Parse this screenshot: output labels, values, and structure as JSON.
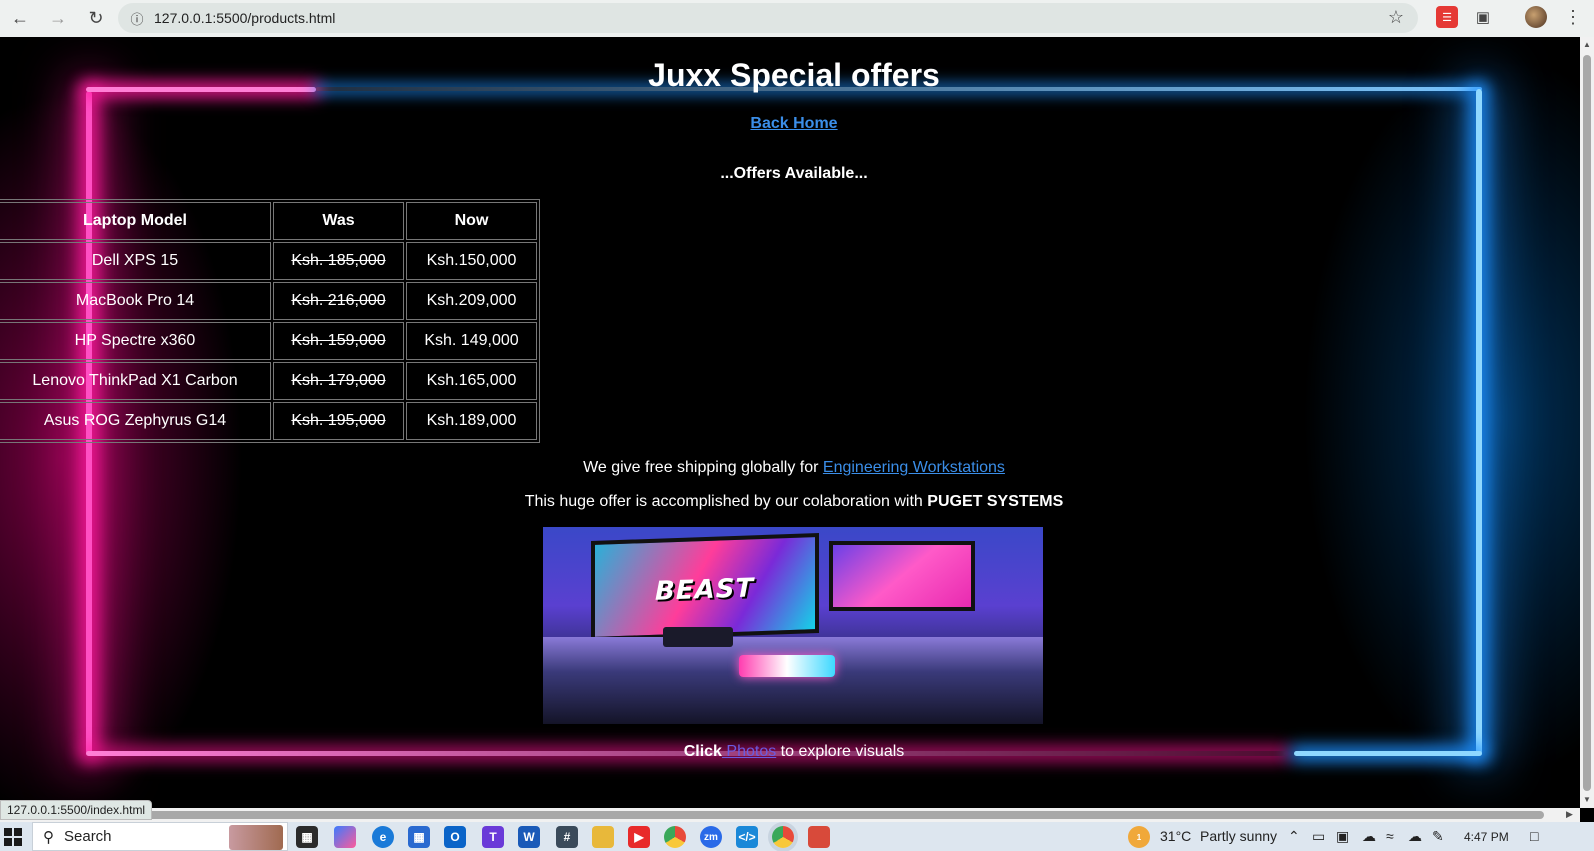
{
  "browser": {
    "url": "127.0.0.1:5500/products.html",
    "status_url": "127.0.0.1:5500/index.html"
  },
  "page": {
    "title": "Juxx Special offers",
    "back_link": "Back Home",
    "offers_heading": "...Offers Available...",
    "table": {
      "headers": [
        "Laptop Model",
        "Was",
        "Now"
      ],
      "rows": [
        {
          "model": "Dell XPS 15",
          "was": "Ksh. 185,000",
          "now": "Ksh.150,000"
        },
        {
          "model": "MacBook Pro 14",
          "was": "Ksh. 216,000",
          "now": "Ksh.209,000"
        },
        {
          "model": "HP Spectre x360",
          "was": "Ksh. 159,000",
          "now": "Ksh. 149,000"
        },
        {
          "model": "Lenovo ThinkPad X1 Carbon",
          "was": "Ksh. 179,000",
          "now": "Ksh.165,000"
        },
        {
          "model": "Asus ROG Zephyrus G14",
          "was": "Ksh. 195,000",
          "now": "Ksh.189,000"
        }
      ]
    },
    "shipping_text": "We give free shipping globally for",
    "shipping_link": "Engineering Workstations",
    "collab_text": "This huge offer is accomplished by our colaboration with",
    "collab_partner": "PUGET SYSTEMS",
    "image_caption_text": "BEAST",
    "click_prefix": "Click",
    "click_link": " Photos",
    "click_suffix": " to explore visuals"
  },
  "taskbar": {
    "search_label": "Search",
    "weather_temp": "31°C",
    "weather_desc": "Partly sunny",
    "time": "4:47 PM",
    "weather_badge": "1"
  },
  "colors": {
    "link": "#3b8ee8",
    "neon_pink": "#ff1a9e",
    "neon_blue": "#1e90ff"
  }
}
